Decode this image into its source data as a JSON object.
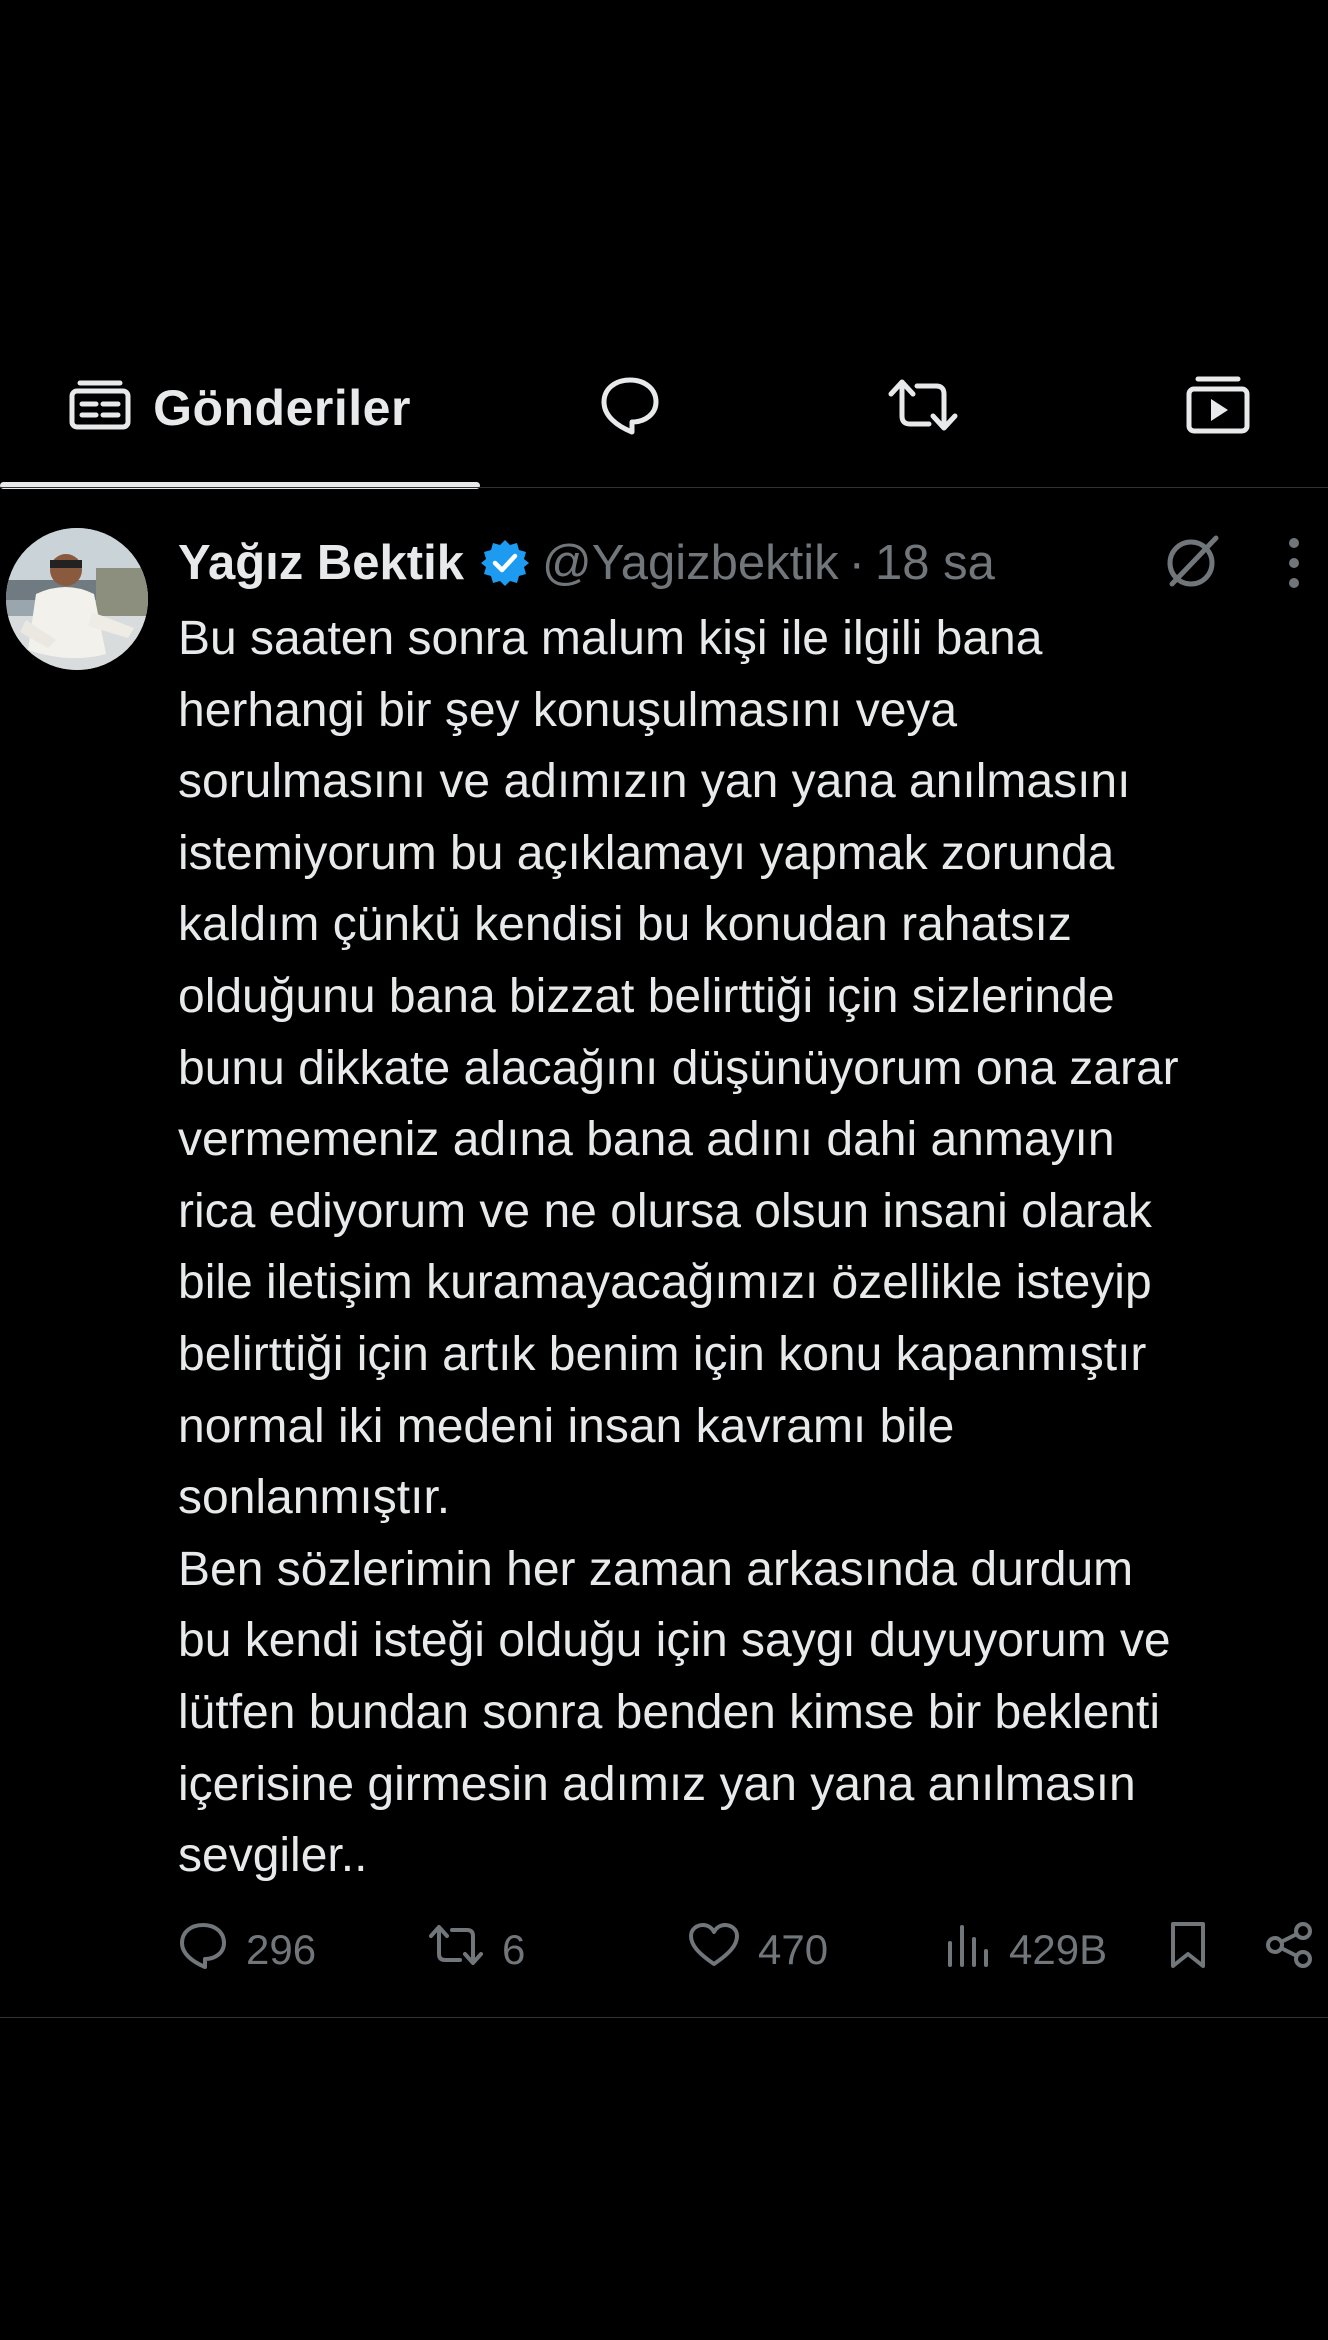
{
  "tabs": [
    {
      "label": "Gönderiler",
      "icon": "posts-icon",
      "active": true
    },
    {
      "label": "",
      "icon": "reply-bubble-icon",
      "active": false
    },
    {
      "label": "",
      "icon": "repost-icon",
      "active": false
    },
    {
      "label": "",
      "icon": "media-play-icon",
      "active": false
    }
  ],
  "post": {
    "author": {
      "name": "Yağız Bektik",
      "handle": "@Yagizbektik",
      "verified": true,
      "avatar_icon": "profile-photo"
    },
    "separator": "·",
    "time": "18 sa",
    "lines": [
      "Bu saaten sonra malum kişi ile ilgili bana",
      "herhangi bir şey konuşulmasını veya",
      "sorulmasını ve adımızın yan yana anılmasını",
      "istemiyorum bu açıklamayı yapmak zorunda",
      "kaldım çünkü kendisi bu konudan rahatsız",
      "olduğunu bana bizzat belirttiği için sizlerinde",
      "bunu dikkate alacağını düşünüyorum ona zarar",
      "vermemeniz adına bana adını dahi anmayın",
      "rica ediyorum ve ne olursa olsun insani olarak",
      "bile iletişim kuramayacağımızı özellikle isteyip",
      "belirttiği için artık benim için konu kapanmıştır",
      "normal iki medeni insan kavramı bile",
      "sonlanmıştır.",
      "Ben sözlerimin her zaman arkasında durdum",
      "bu kendi isteği olduğu için saygı duyuyorum ve",
      "lütfen bundan sonra benden kimse bir beklenti",
      "içerisine girmesin adımız yan yana anılmasın",
      "sevgiler.."
    ],
    "stats": {
      "replies": "296",
      "reposts": "6",
      "likes": "470",
      "views": "429B"
    }
  },
  "colors": {
    "background": "#000000",
    "text_primary": "#e7e9ea",
    "text_secondary": "#71767b",
    "verified_blue": "#1d9bf0",
    "divider": "#2f3336"
  }
}
